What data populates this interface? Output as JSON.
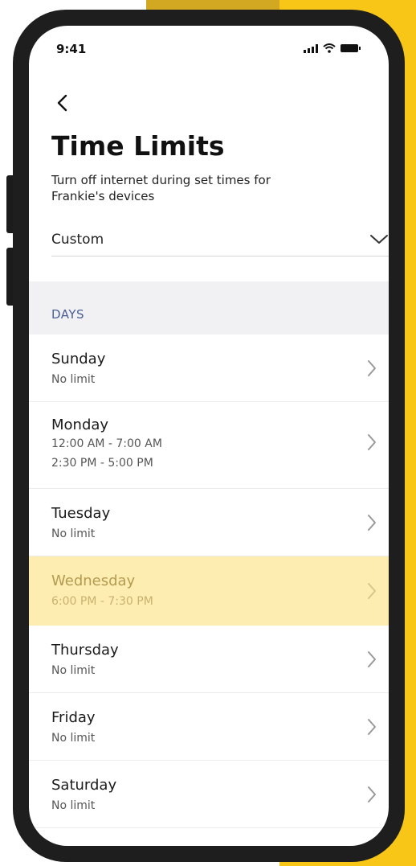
{
  "status_bar": {
    "time": "9:41"
  },
  "header": {
    "title": "Time Limits",
    "subtitle": "Turn off internet during set times for\nFrankie's devices"
  },
  "schedule_select": {
    "value": "Custom"
  },
  "section": {
    "label": "DAYS"
  },
  "days": [
    {
      "name": "Sunday",
      "times": "No limit",
      "selected": false
    },
    {
      "name": "Monday",
      "times": "12:00 AM - 7:00 AM\n2:30 PM - 5:00 PM",
      "selected": false
    },
    {
      "name": "Tuesday",
      "times": "No limit",
      "selected": false
    },
    {
      "name": "Wednesday",
      "times": "6:00 PM - 7:30 PM",
      "selected": true
    },
    {
      "name": "Thursday",
      "times": "No limit",
      "selected": false
    },
    {
      "name": "Friday",
      "times": "No limit",
      "selected": false
    },
    {
      "name": "Saturday",
      "times": "No limit",
      "selected": false
    }
  ],
  "colors": {
    "accent": "#f8c617",
    "highlight_row": "#fdedb0",
    "section_text": "#4a5e96"
  }
}
